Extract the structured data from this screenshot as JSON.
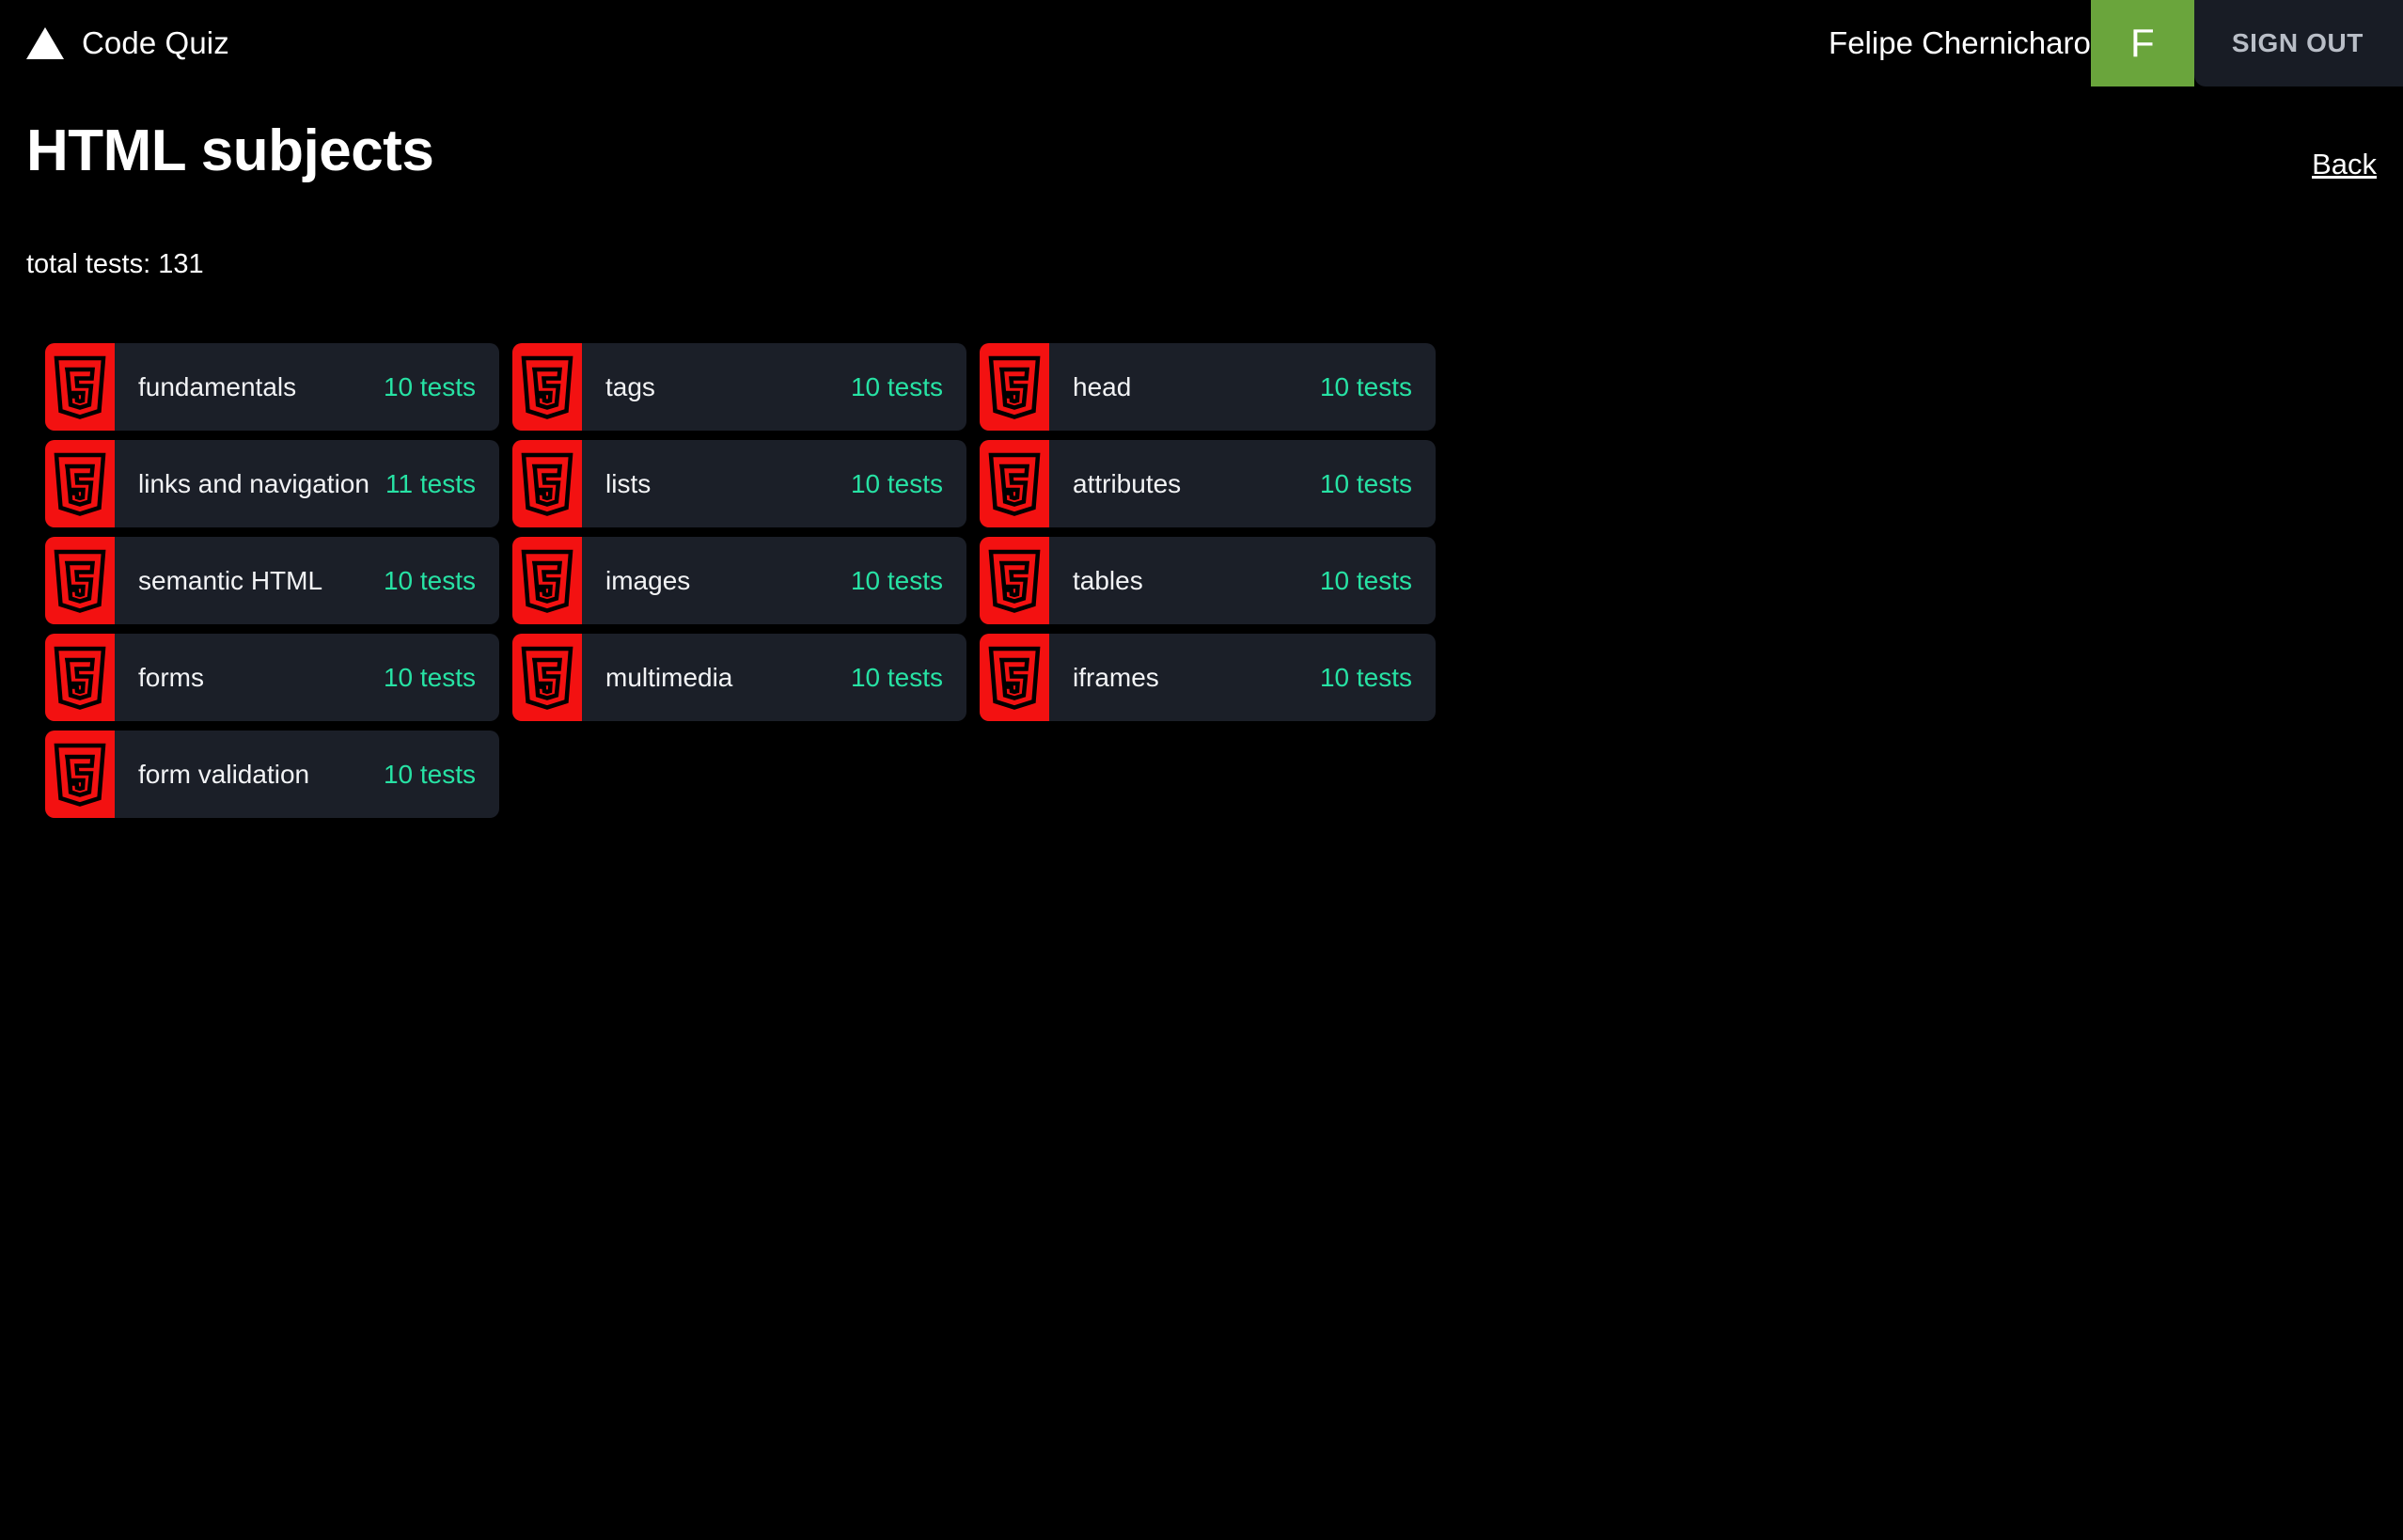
{
  "header": {
    "logo_icon": "triangle-logo-icon",
    "brand_name": "Code Quiz",
    "user_name": "Felipe Chernicharo",
    "avatar_initial": "F",
    "sign_out_label": "SIGN OUT",
    "avatar_color": "#6aa53c"
  },
  "page": {
    "title": "HTML subjects",
    "back_label": "Back",
    "total_tests_label": "total tests: 131",
    "accent_color": "#27e2a4",
    "card_background": "#1b1f28",
    "icon_background": "#f31111",
    "page_background": "#000000"
  },
  "subjects": [
    {
      "name": "fundamentals",
      "tests": "10 tests",
      "icon": "html5-logo-icon"
    },
    {
      "name": "tags",
      "tests": "10 tests",
      "icon": "html5-logo-icon"
    },
    {
      "name": "head",
      "tests": "10 tests",
      "icon": "html5-logo-icon"
    },
    {
      "name": "links and navigation",
      "tests": "11 tests",
      "icon": "html5-logo-icon"
    },
    {
      "name": "lists",
      "tests": "10 tests",
      "icon": "html5-logo-icon"
    },
    {
      "name": "attributes",
      "tests": "10 tests",
      "icon": "html5-logo-icon"
    },
    {
      "name": "semantic HTML",
      "tests": "10 tests",
      "icon": "html5-logo-icon"
    },
    {
      "name": "images",
      "tests": "10 tests",
      "icon": "html5-logo-icon"
    },
    {
      "name": "tables",
      "tests": "10 tests",
      "icon": "html5-logo-icon"
    },
    {
      "name": "forms",
      "tests": "10 tests",
      "icon": "html5-logo-icon"
    },
    {
      "name": "multimedia",
      "tests": "10 tests",
      "icon": "html5-logo-icon"
    },
    {
      "name": "iframes",
      "tests": "10 tests",
      "icon": "html5-logo-icon"
    },
    {
      "name": "form validation",
      "tests": "10 tests",
      "icon": "html5-logo-icon"
    }
  ]
}
